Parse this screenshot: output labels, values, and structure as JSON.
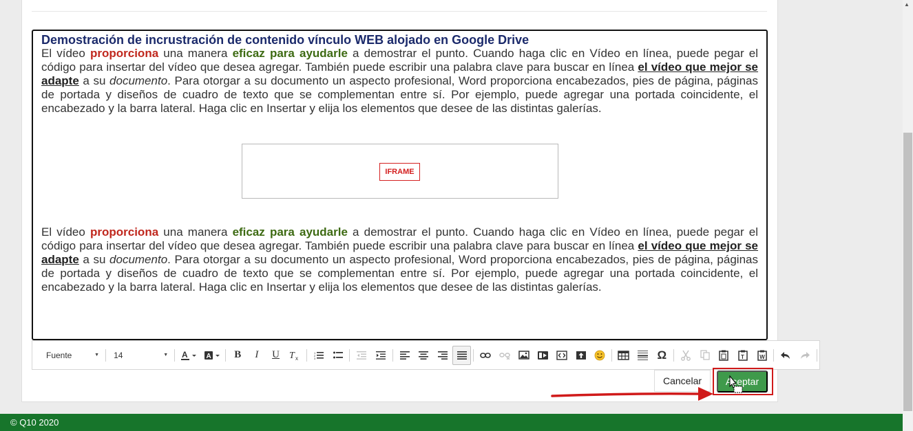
{
  "editor": {
    "title": "Demostración de incrustración de contenido vínculo WEB alojado en Google Drive",
    "paragraph": {
      "t1": "El vídeo ",
      "red": "proporciona",
      "t2": " una manera ",
      "green": "eficaz para ayudarle",
      "t3": " a demostrar el punto. Cuando haga clic en Vídeo en línea, puede pegar el código para insertar del vídeo que desea agregar. También puede escribir una palabra clave para buscar en línea ",
      "underline": "el vídeo que mejor se adapte",
      "t4": " a su ",
      "italic": "documento",
      "t5": ". Para otorgar a su documento un aspecto profesional, Word proporciona encabezados, pies de página, páginas de portada y diseños de cuadro de texto que se complementan entre sí. Por ejemplo, puede agregar una portada coincidente, el encabezado y la barra lateral. Haga clic en Insertar y elija los elementos que desee de las distintas galerías."
    },
    "iframe_label": "IFRAME"
  },
  "toolbar": {
    "font_label": "Fuente",
    "size_label": "14"
  },
  "actions": {
    "cancel_label": "Cancelar",
    "accept_label": "Aceptar"
  },
  "footer": {
    "text": "© Q10 2020"
  },
  "colors": {
    "accept_green": "#3f9a4b",
    "footer_green": "#17752b",
    "annotation_red": "#d01a1a",
    "title_navy": "#1b2a6b"
  }
}
